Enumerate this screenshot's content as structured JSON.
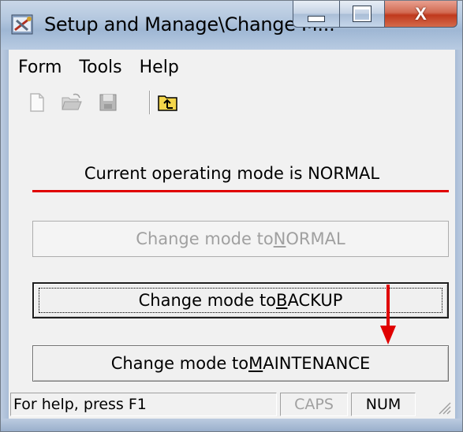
{
  "window": {
    "title": "Setup and Manage\\Change M...",
    "app_icon": "tools-app-icon",
    "controls": {
      "minimize": "minimize-icon",
      "maximize": "maximize-icon",
      "close_label": "X"
    }
  },
  "menu": {
    "items": [
      "Form",
      "Tools",
      "Help"
    ]
  },
  "toolbar": {
    "buttons": [
      "new-document-icon",
      "open-folder-icon",
      "save-disk-icon",
      "up-folder-icon"
    ]
  },
  "main": {
    "mode_status": "Current operating mode is NORMAL",
    "accent_line_color": "#e00000",
    "buttons": {
      "normal": {
        "prefix": "Change mode to ",
        "accel": "N",
        "suffix": "ORMAL",
        "enabled": false
      },
      "backup": {
        "prefix": "Change mode to ",
        "accel": "B",
        "suffix": "ACKUP",
        "enabled": true,
        "focused": true
      },
      "maintenance": {
        "prefix": "Change mode to ",
        "accel": "M",
        "suffix": "AINTENANCE",
        "enabled": true
      }
    },
    "annotation_arrow_color": "#e00000"
  },
  "statusbar": {
    "help": "For help, press F1",
    "caps": "CAPS",
    "num": "NUM"
  }
}
